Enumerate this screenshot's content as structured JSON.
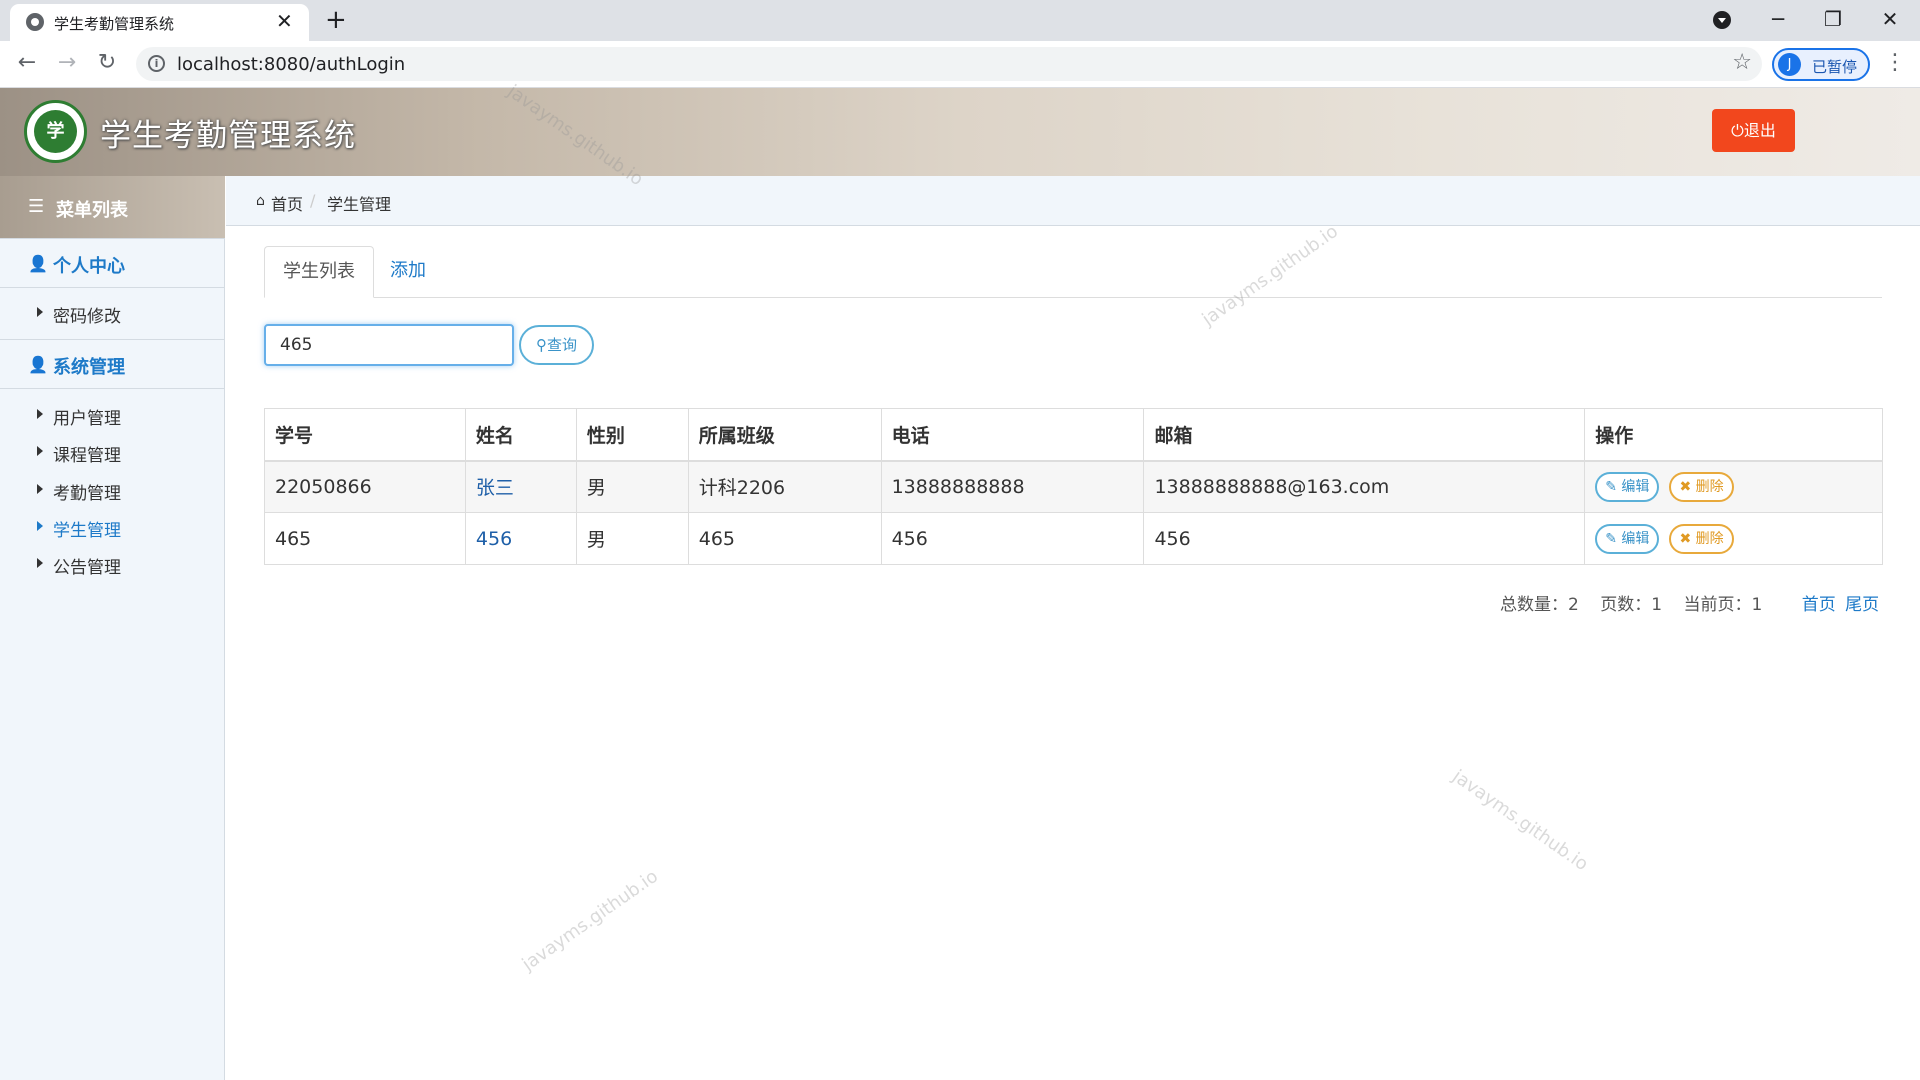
{
  "browser": {
    "tab_title": "学生考勤管理系统",
    "tab_close": "✕",
    "new_tab": "+",
    "url": "localhost:8080/authLogin",
    "profile_initial": "J",
    "profile_status": "已暂停"
  },
  "header": {
    "logo_text": "学",
    "title": "学生考勤管理系统",
    "logout_label": "⏻退出"
  },
  "sidebar": {
    "menu_title": "菜单列表",
    "sections": [
      {
        "label": "个人中心",
        "items": [
          {
            "label": "密码修改",
            "active": false
          }
        ]
      },
      {
        "label": "系统管理",
        "items": [
          {
            "label": "用户管理",
            "active": false
          },
          {
            "label": "课程管理",
            "active": false
          },
          {
            "label": "考勤管理",
            "active": false
          },
          {
            "label": "学生管理",
            "active": true
          },
          {
            "label": "公告管理",
            "active": false
          }
        ]
      }
    ]
  },
  "breadcrumb": {
    "home": "首页",
    "separator": "/",
    "current": "学生管理"
  },
  "tabs": {
    "list": "学生列表",
    "add": "添加"
  },
  "search": {
    "value": "465",
    "button": "查询"
  },
  "table": {
    "headers": [
      "学号",
      "姓名",
      "性别",
      "所属班级",
      "电话",
      "邮箱",
      "操作"
    ],
    "rows": [
      {
        "id": "22050866",
        "name": "张三",
        "gender": "男",
        "class": "计科2206",
        "phone": "13888888888",
        "email": "13888888888@163.com"
      },
      {
        "id": "465",
        "name": "456",
        "gender": "男",
        "class": "465",
        "phone": "456",
        "email": "456"
      }
    ],
    "edit_label": "✎ 编辑",
    "delete_label": "✖ 删除"
  },
  "pagination": {
    "total": "总数量：2",
    "pages": "页数：1",
    "current": "当前页：1",
    "first": "首页",
    "last": "尾页"
  },
  "watermark": "javayms.github.io"
}
